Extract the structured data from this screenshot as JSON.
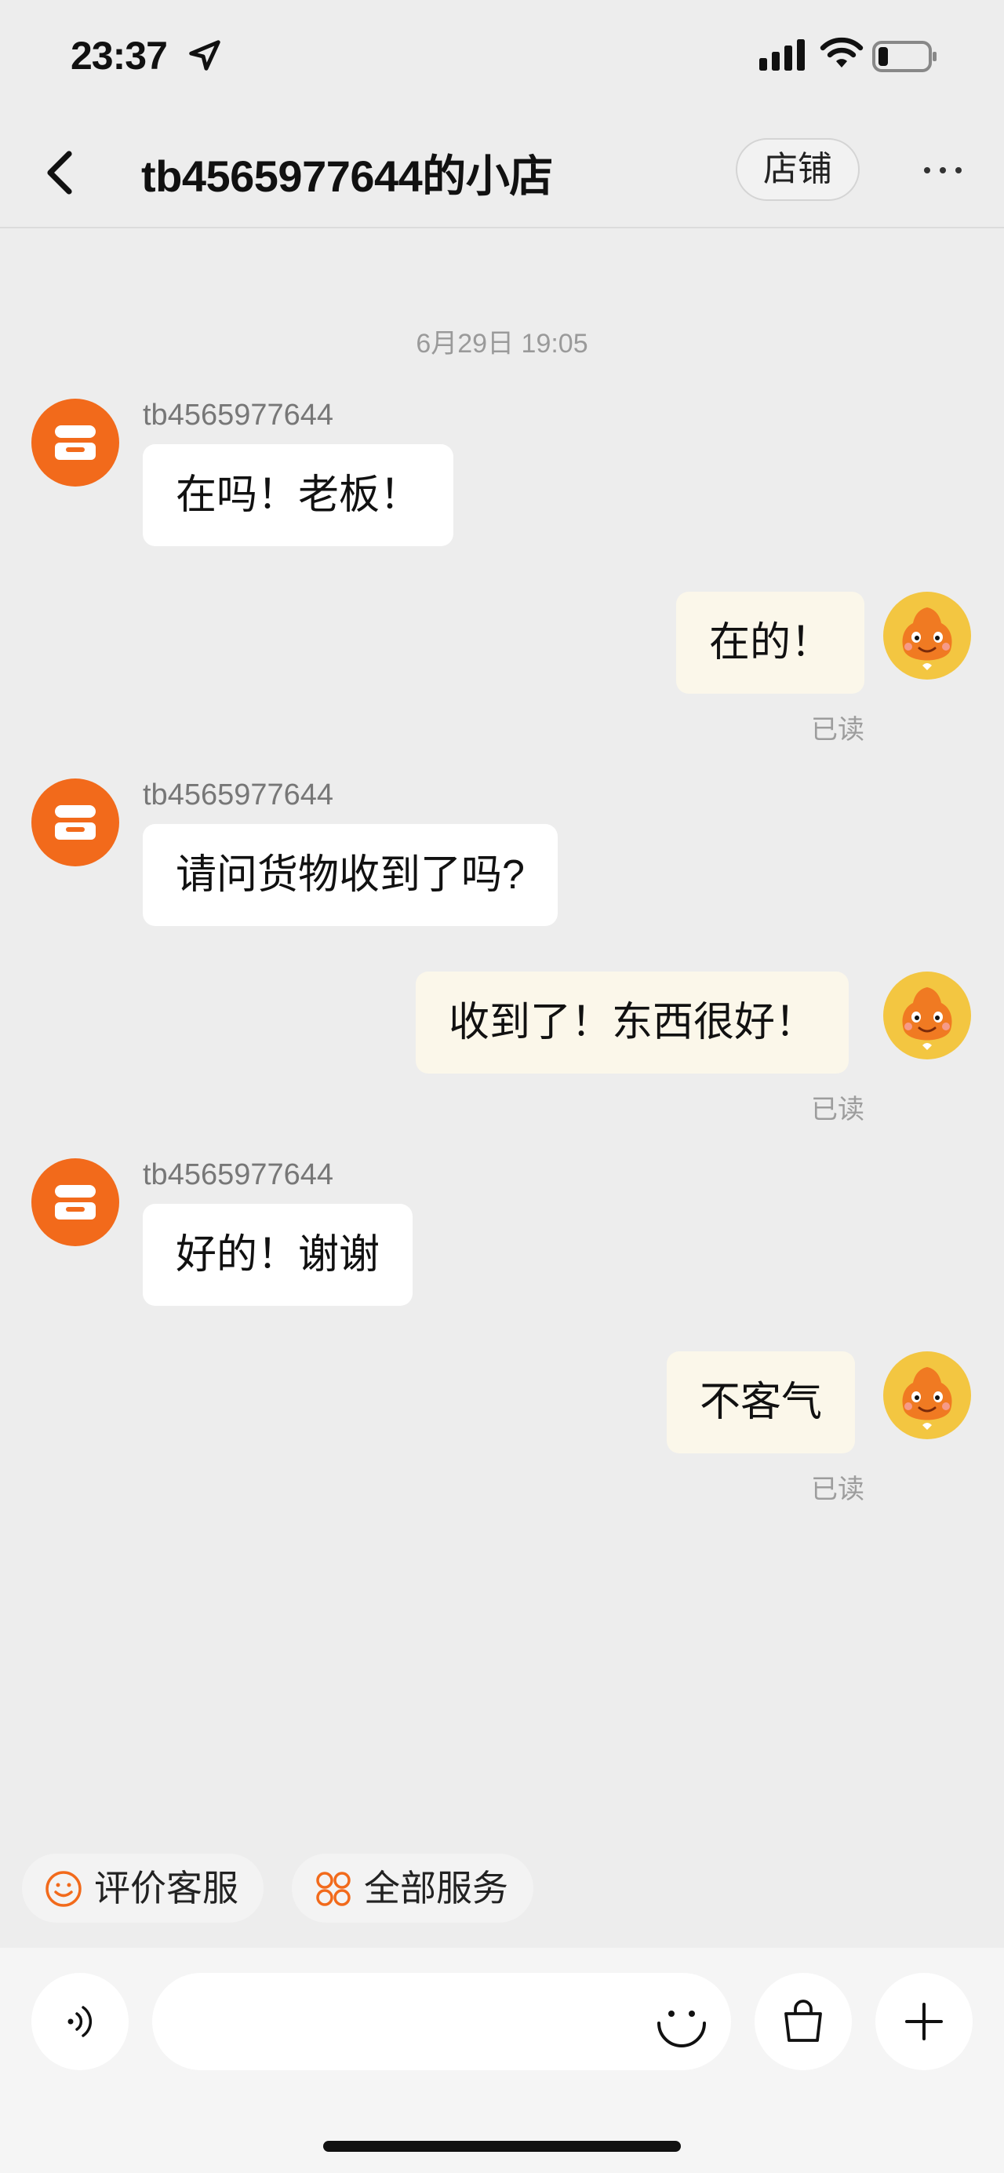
{
  "status_bar": {
    "time": "23:37"
  },
  "nav": {
    "title": "tb4565977644的小店",
    "shop_button": "店铺"
  },
  "chat": {
    "timestamp": "6月29日 19:05",
    "messages": [
      {
        "sender": "tb4565977644",
        "text": "在吗！老板！"
      },
      {
        "text": "在的！",
        "read": "已读"
      },
      {
        "sender": "tb4565977644",
        "text": "请问货物收到了吗?"
      },
      {
        "text": "收到了！东西很好！",
        "read": "已读"
      },
      {
        "sender": "tb4565977644",
        "text": "好的！谢谢"
      },
      {
        "text": "不客气",
        "read": "已读"
      }
    ]
  },
  "quick_actions": [
    {
      "label": "评价客服",
      "icon": "smile-icon"
    },
    {
      "label": "全部服务",
      "icon": "services-grid-icon"
    }
  ],
  "input": {
    "placeholder": ""
  },
  "colors": {
    "accent": "#f26a1b",
    "outgoing_bubble": "#fbf7ea",
    "incoming_bubble": "#ffffff",
    "background": "#ededed"
  }
}
